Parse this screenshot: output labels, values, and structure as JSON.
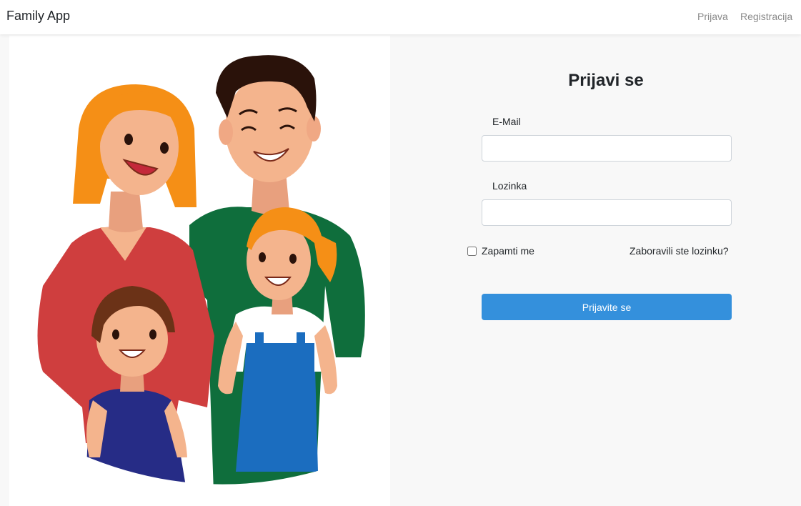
{
  "navbar": {
    "brand": "Family App",
    "links": {
      "login": "Prijava",
      "register": "Registracija"
    }
  },
  "illustration": {
    "name": "family-illustration"
  },
  "form": {
    "title": "Prijavi se",
    "email_label": "E-Mail",
    "email_value": "",
    "password_label": "Lozinka",
    "password_value": "",
    "remember_label": "Zapamti me",
    "remember_checked": false,
    "forgot_label": "Zaboravili ste lozinku?",
    "submit_label": "Prijavite se"
  },
  "colors": {
    "accent": "#3490dc",
    "navbar_bg": "#ffffff",
    "page_bg": "#f8f8f8"
  }
}
